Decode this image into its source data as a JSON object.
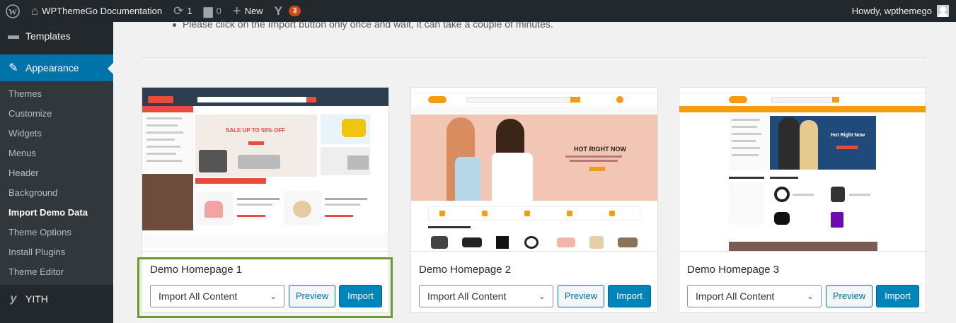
{
  "adminbar": {
    "site_name": "WPThemeGo Documentation",
    "updates_count": "1",
    "comments_count": "0",
    "new_label": "New",
    "yoast_badge": "3",
    "howdy": "Howdy, wpthemego"
  },
  "sidebar": {
    "templates": "Templates",
    "appearance": "Appearance",
    "submenu": [
      "Themes",
      "Customize",
      "Widgets",
      "Menus",
      "Header",
      "Background",
      "Import Demo Data",
      "Theme Options",
      "Install Plugins",
      "Theme Editor"
    ],
    "yith": "YITH"
  },
  "main": {
    "notice": "Please click on the Import button only once and wait, it can take a couple of minutes."
  },
  "demos": [
    {
      "title": "Demo Homepage 1",
      "select_value": "Import All Content",
      "preview_label": "Preview",
      "import_label": "Import",
      "hero_text": "SALE UP TO 50% OFF"
    },
    {
      "title": "Demo Homepage 2",
      "select_value": "Import All Content",
      "preview_label": "Preview",
      "import_label": "Import",
      "hero_text": "HOT RIGHT NOW"
    },
    {
      "title": "Demo Homepage 3",
      "select_value": "Import All Content",
      "preview_label": "Preview",
      "import_label": "Import",
      "hero_text": "Hot Right Now"
    }
  ],
  "colors": {
    "accent": "#0073aa",
    "highlight_border": "#6a9a2f",
    "theme_orange": "#f39c12",
    "theme_red": "#e74c3c"
  }
}
